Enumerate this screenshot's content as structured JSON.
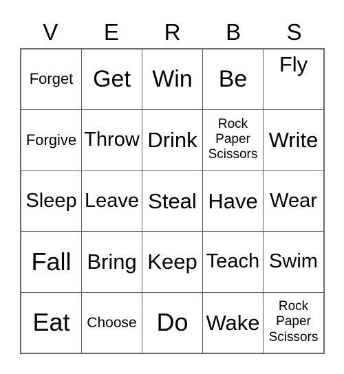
{
  "card": {
    "header_letters": [
      "V",
      "E",
      "R",
      "B",
      "S"
    ],
    "grid_line_color": "#5b5b5b",
    "outer_border_color": "#6a6a6a",
    "background_color": "#ffffff",
    "text_color": "#000000",
    "rows": [
      [
        {
          "text": "Forget",
          "size": "xs"
        },
        {
          "text": "Get",
          "size": "xl"
        },
        {
          "text": "Win",
          "size": "xl"
        },
        {
          "text": "Be",
          "size": "xl"
        },
        {
          "text": "Fly",
          "size": "l",
          "align": "top"
        }
      ],
      [
        {
          "text": "Forgive",
          "size": "xs"
        },
        {
          "text": "Throw",
          "size": "m"
        },
        {
          "text": "Drink",
          "size": "l"
        },
        {
          "text": "Rock\nPaper\nScissors",
          "size": "multi",
          "align": "rps"
        },
        {
          "text": "Write",
          "size": "l"
        }
      ],
      [
        {
          "text": "Sleep",
          "size": "m"
        },
        {
          "text": "Leave",
          "size": "m"
        },
        {
          "text": "Steal",
          "size": "l"
        },
        {
          "text": "Have",
          "size": "l"
        },
        {
          "text": "Wear",
          "size": "m"
        }
      ],
      [
        {
          "text": "Fall",
          "size": "xxl"
        },
        {
          "text": "Bring",
          "size": "l"
        },
        {
          "text": "Keep",
          "size": "l"
        },
        {
          "text": "Teach",
          "size": "m"
        },
        {
          "text": "Swim",
          "size": "m"
        }
      ],
      [
        {
          "text": "Eat",
          "size": "xxl"
        },
        {
          "text": "Choose",
          "size": "xxs"
        },
        {
          "text": "Do",
          "size": "xxl"
        },
        {
          "text": "Wake",
          "size": "l"
        },
        {
          "text": "Rock\nPaper\nScissors",
          "size": "multi",
          "align": "rps"
        }
      ]
    ]
  }
}
